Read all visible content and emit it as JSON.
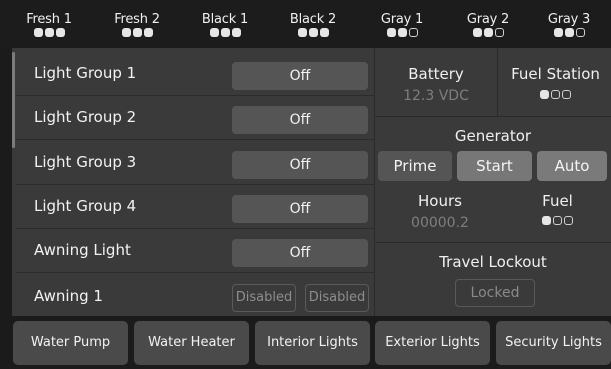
{
  "tanks": [
    {
      "label": "Fresh 1",
      "level": "3/3"
    },
    {
      "label": "Fresh 2",
      "level": "3/3"
    },
    {
      "label": "Black 1",
      "level": "3/3"
    },
    {
      "label": "Black 2",
      "level": "3/3"
    },
    {
      "label": "Gray 1",
      "level": "2/3"
    },
    {
      "label": "Gray 2",
      "level": "2/3"
    },
    {
      "label": "Gray 3",
      "level": "2/3"
    }
  ],
  "lights": [
    {
      "label": "Light Group 1",
      "state": "Off"
    },
    {
      "label": "Light Group 2",
      "state": "Off"
    },
    {
      "label": "Light Group 3",
      "state": "Off"
    },
    {
      "label": "Light Group 4",
      "state": "Off"
    },
    {
      "label": "Awning Light",
      "state": "Off"
    }
  ],
  "awning": {
    "label": "Awning 1",
    "btn1": "Disabled",
    "btn2": "Disabled"
  },
  "battery": {
    "label": "Battery",
    "value": "12.3 VDC"
  },
  "fuel_station": {
    "label": "Fuel Station",
    "level": "1/3"
  },
  "generator": {
    "label": "Generator",
    "prime": "Prime",
    "start": "Start",
    "auto": "Auto"
  },
  "hours": {
    "label": "Hours",
    "value": "00000.2"
  },
  "fuel": {
    "label": "Fuel",
    "level": "1/3"
  },
  "travel_lockout": {
    "label": "Travel Lockout",
    "button": "Locked"
  },
  "nav": [
    "Water Pump",
    "Water Heater",
    "Interior Lights",
    "Exterior Lights",
    "Security Lights"
  ],
  "colors": {
    "background": "#1b1b1b",
    "panel": "#3a3a3a",
    "button": "#555555",
    "nav_button": "#4a4a4a",
    "active_button": "#7a7a7a"
  }
}
